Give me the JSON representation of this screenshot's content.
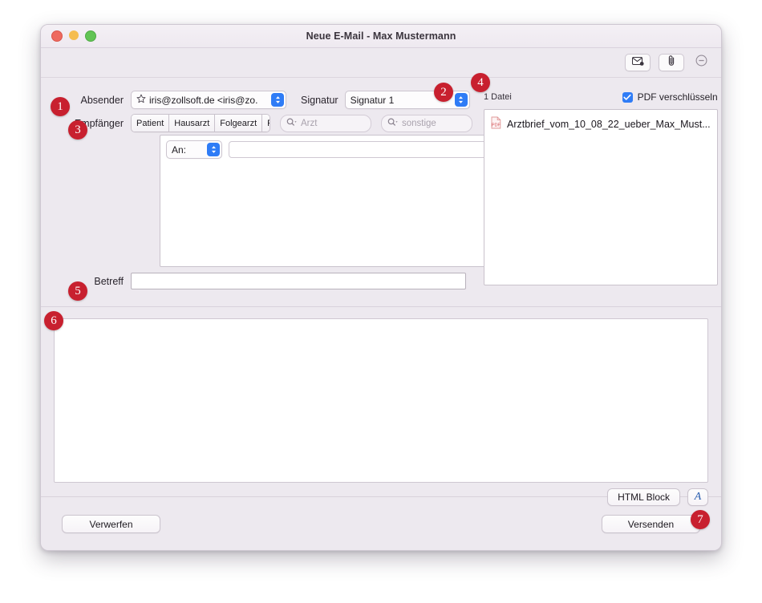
{
  "window": {
    "title": "Neue E-Mail - Max Mustermann",
    "traffic_lights": [
      "close-red",
      "minimize-yellow",
      "zoom-green"
    ]
  },
  "toolbar": {
    "mail_icon": "envelope-icon",
    "attach_icon": "paperclip-icon",
    "more_icon": "circle-minus-icon"
  },
  "form": {
    "sender_label": "Absender",
    "sender_value": "iris@zollsoft.de <iris@zo...",
    "sender_star_icon": "star-icon",
    "signature_label": "Signatur",
    "signature_value": "Signatur 1",
    "recipients_label": "Empfänger",
    "recipient_types": [
      "Patient",
      "Hausarzt",
      "Folgearzt",
      "Facharzt"
    ],
    "search_doctor_placeholder": "Arzt",
    "search_other_placeholder": "sonstige",
    "an_label": "An:",
    "an_value": "",
    "subject_label": "Betreff",
    "subject_value": ""
  },
  "attachments": {
    "count_label": "1 Datei",
    "encrypt_label": "PDF verschlüsseln",
    "encrypt_checked": true,
    "files": [
      {
        "name": "Arztbrief_vom_10_08_22_ueber_Max_Must...",
        "icon": "pdf-file-icon"
      }
    ]
  },
  "message": {
    "body_value": "",
    "html_block_label": "HTML Block",
    "font_button_label": "A"
  },
  "footer": {
    "discard_label": "Verwerfen",
    "send_label": "Versenden"
  },
  "badges": {
    "b1": "1",
    "b2": "2",
    "b3": "3",
    "b4": "4",
    "b5": "5",
    "b6": "6",
    "b7": "7"
  },
  "colors": {
    "badge": "#C8202F",
    "accent_blue": "#2F7CF6",
    "window_bg": "#EDE9EF"
  }
}
